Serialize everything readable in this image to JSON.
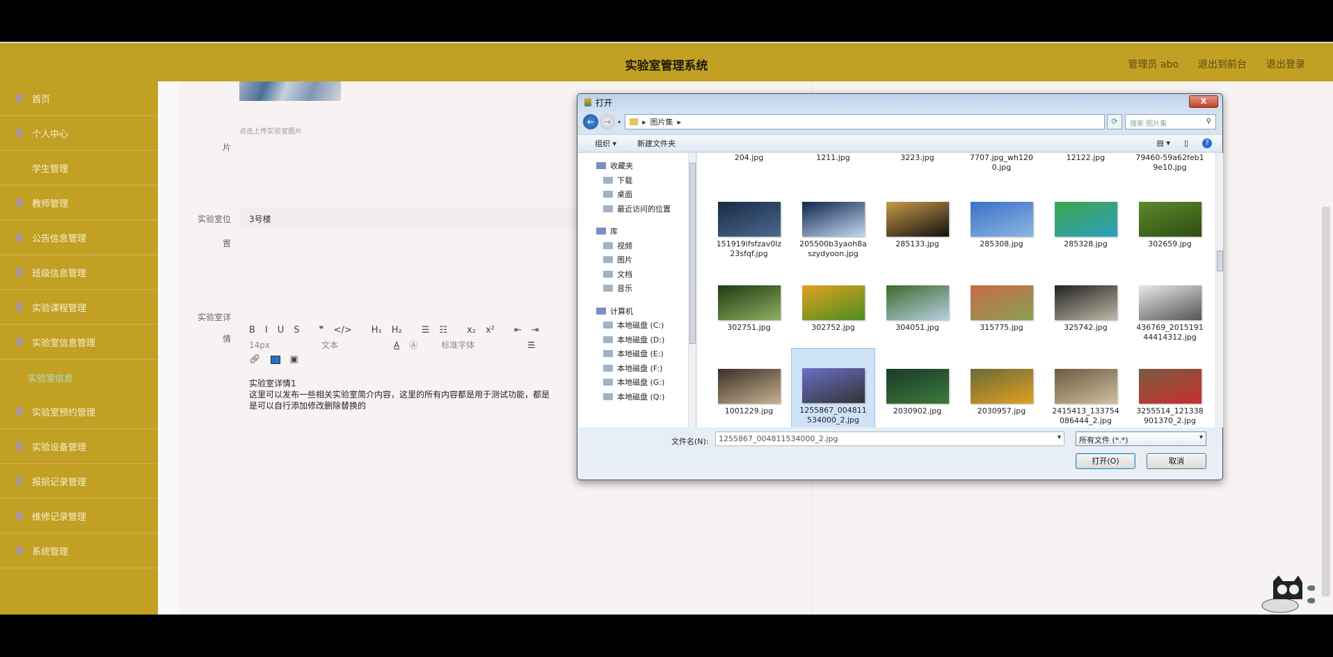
{
  "header": {
    "title": "实验室管理系统",
    "user": "管理员 abo",
    "to_front": "退出到前台",
    "logout": "退出登录"
  },
  "sidebar": {
    "items": [
      {
        "label": "首页"
      },
      {
        "label": "个人中心"
      },
      {
        "label": "学生管理"
      },
      {
        "label": "教师管理"
      },
      {
        "label": "公告信息管理"
      },
      {
        "label": "班级信息管理"
      },
      {
        "label": "实验课程管理"
      },
      {
        "label": "实验室信息管理"
      },
      {
        "label": "实验室信息",
        "sub": true
      },
      {
        "label": "实验室预约管理"
      },
      {
        "label": "实验设备管理"
      },
      {
        "label": "报损记录管理"
      },
      {
        "label": "维修记录管理"
      },
      {
        "label": "系统管理"
      }
    ]
  },
  "form": {
    "image_label_tail": "片",
    "image_hint": "点击上传实验室图片",
    "location_label": "实验室位",
    "location_label_tail": "置",
    "location_value": "3号楼",
    "detail_label": "实验室详",
    "detail_label_tail": "情",
    "toolbar": {
      "row1": [
        "B",
        "I",
        "U",
        "S",
        "❞",
        "</>",
        "H₁",
        "H₂",
        "☰",
        "☷",
        "x₂",
        "x²",
        "⇤",
        "⇥"
      ],
      "font_size": "14px",
      "text_type": "文本",
      "font_family": "标准字体"
    },
    "content": [
      "实验室详情1",
      "这里可以发布一些相关实验室简介内容，这里的所有内容都是用于测试功能，都是",
      "是可以自行添加修改删除替换的"
    ]
  },
  "dialog": {
    "title": "打开",
    "close": "X",
    "path": "图片集",
    "search_placeholder": "搜索 图片集",
    "organize": "组织 ▾",
    "new_folder": "新建文件夹",
    "nav": [
      {
        "label": "收藏夹",
        "group": true
      },
      {
        "label": "下载"
      },
      {
        "label": "桌面"
      },
      {
        "label": "最近访问的位置"
      },
      {
        "label": "库",
        "group": true,
        "gap": true
      },
      {
        "label": "视频"
      },
      {
        "label": "图片"
      },
      {
        "label": "文档"
      },
      {
        "label": "音乐"
      },
      {
        "label": "计算机",
        "group": true,
        "gap": true
      },
      {
        "label": "本地磁盘 (C:)"
      },
      {
        "label": "本地磁盘 (D:)"
      },
      {
        "label": "本地磁盘 (E:)"
      },
      {
        "label": "本地磁盘 (F:)"
      },
      {
        "label": "本地磁盘 (G:)"
      },
      {
        "label": "本地磁盘 (Q:)"
      }
    ],
    "files": [
      {
        "name": "204.jpg",
        "top": true
      },
      {
        "name": "1211.jpg",
        "top": true
      },
      {
        "name": "3223.jpg",
        "top": true
      },
      {
        "name": "7707.jpg_wh1200.jpg",
        "top": true
      },
      {
        "name": "12122.jpg",
        "top": true
      },
      {
        "name": "79460-59a62feb19e10.jpg",
        "top": true
      },
      {
        "name": "151919ifsfzav0lz23sfqf.jpg",
        "c1": "#1b2a44",
        "c2": "#4a6a90"
      },
      {
        "name": "205500b3yaoh8aszydyoon.jpg",
        "c1": "#0e2550",
        "c2": "#c6d8f0"
      },
      {
        "name": "285133.jpg",
        "c1": "#c89a45",
        "c2": "#111"
      },
      {
        "name": "285308.jpg",
        "c1": "#3d6fc8",
        "c2": "#8ab7e0"
      },
      {
        "name": "285328.jpg",
        "c1": "#3fa64a",
        "c2": "#2a9fc0"
      },
      {
        "name": "302659.jpg",
        "c1": "#5e8a2a",
        "c2": "#2e4d15"
      },
      {
        "name": "302751.jpg",
        "c1": "#1f3a12",
        "c2": "#8fb060"
      },
      {
        "name": "302752.jpg",
        "c1": "#e0a020",
        "c2": "#4c8f1f"
      },
      {
        "name": "304051.jpg",
        "c1": "#3c6a2c",
        "c2": "#b8cfe0"
      },
      {
        "name": "315775.jpg",
        "c1": "#c86a4a",
        "c2": "#8aa050"
      },
      {
        "name": "325742.jpg",
        "c1": "#222",
        "c2": "#c0b8a8"
      },
      {
        "name": "436769_201519144414312.jpg",
        "c1": "#e8e8e8",
        "c2": "#555"
      },
      {
        "name": "1001229.jpg",
        "c1": "#3a3028",
        "c2": "#c8b090"
      },
      {
        "name": "1255867_004811534000_2.jpg",
        "c1": "#6a70c8",
        "c2": "#333",
        "sel": true
      },
      {
        "name": "2030902.jpg",
        "c1": "#1a3a2a",
        "c2": "#3c7a3a"
      },
      {
        "name": "2030957.jpg",
        "c1": "#6a6a3a",
        "c2": "#e0a020"
      },
      {
        "name": "2415413_133754086444_2.jpg",
        "c1": "#6a5a40",
        "c2": "#d0c0a0"
      },
      {
        "name": "3255514_121338901370_2.jpg",
        "c1": "#7a5a40",
        "c2": "#c83030"
      }
    ],
    "filename_label": "文件名(N):",
    "filename_value": "1255867_004811534000_2.jpg",
    "filetype": "所有文件 (*.*)",
    "open": "打开(O)",
    "cancel": "取消"
  }
}
